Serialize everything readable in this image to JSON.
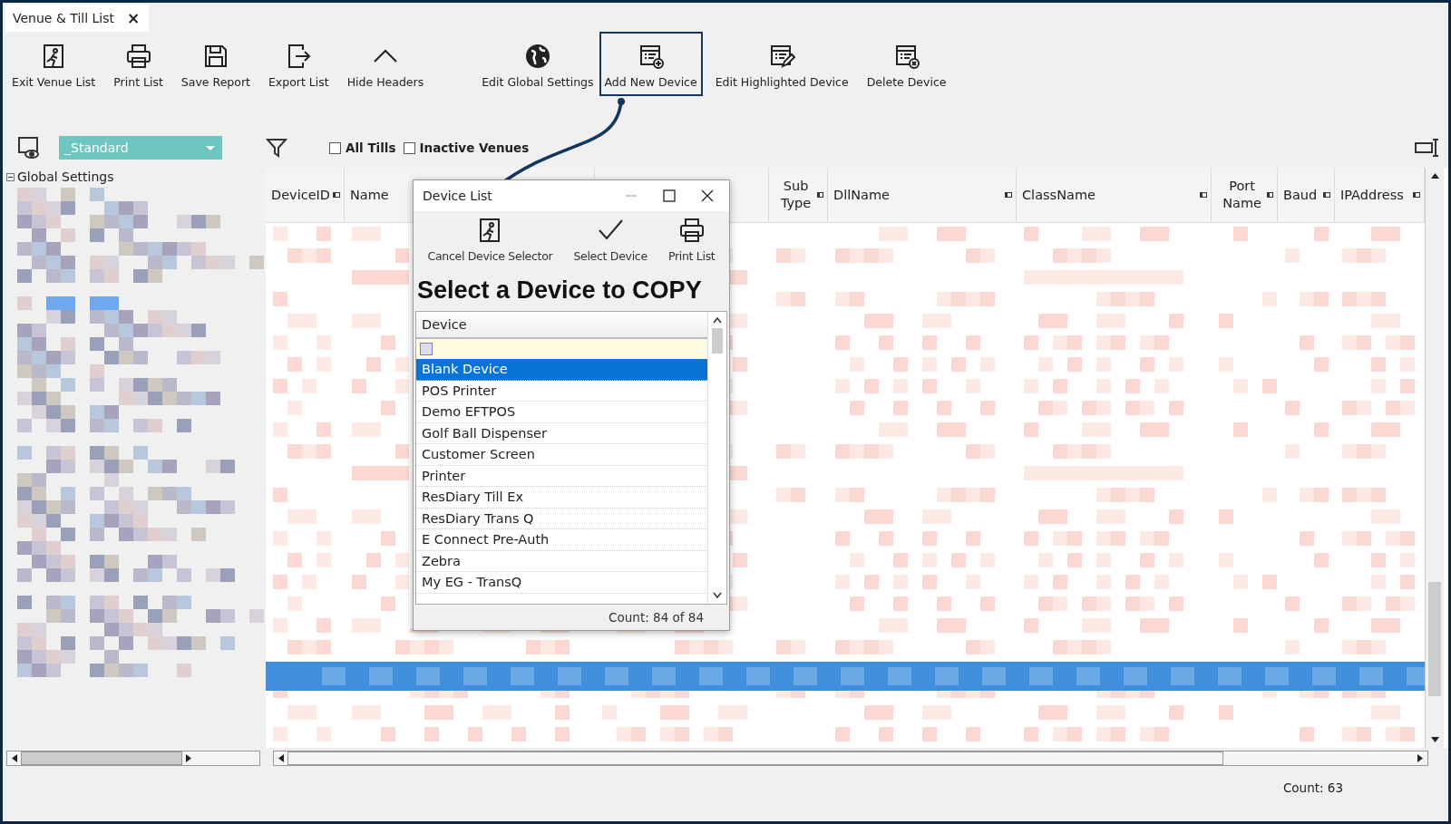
{
  "tab": {
    "title": "Venue & Till List",
    "close": "×"
  },
  "toolbar": [
    {
      "label": "Exit Venue List",
      "highlighted": false
    },
    {
      "label": "Print List",
      "highlighted": false
    },
    {
      "label": "Save Report",
      "highlighted": false
    },
    {
      "label": "Export List",
      "highlighted": false
    },
    {
      "label": "Hide Headers",
      "highlighted": false
    },
    {
      "label": "Edit Global Settings",
      "highlighted": false
    },
    {
      "label": "Add New Device",
      "highlighted": true
    },
    {
      "label": "Edit Highlighted Device",
      "highlighted": false
    },
    {
      "label": "Delete Device",
      "highlighted": false
    }
  ],
  "layout_dropdown": {
    "value": "_Standard"
  },
  "filters": [
    {
      "label": "All Tills",
      "checked": false
    },
    {
      "label": "Inactive Venues",
      "checked": false
    }
  ],
  "tree": {
    "root": "Global Settings",
    "expanded": true
  },
  "grid": {
    "columns": [
      "DeviceID",
      "Name",
      "Sub Type",
      "DllName",
      "ClassName",
      "Port Name",
      "Baud",
      "IPAddress"
    ]
  },
  "dialog": {
    "title": "Device List",
    "toolbar": [
      "Cancel Device Selector",
      "Select Device",
      "Print List"
    ],
    "heading": "Select a Device to COPY",
    "column": "Device",
    "rows": [
      {
        "name": "Blank Device",
        "selected": true
      },
      {
        "name": "POS Printer",
        "selected": false
      },
      {
        "name": "Demo EFTPOS",
        "selected": false
      },
      {
        "name": "Golf Ball Dispenser",
        "selected": false
      },
      {
        "name": "Customer Screen",
        "selected": false
      },
      {
        "name": "Printer",
        "selected": false
      },
      {
        "name": "ResDiary Till Ex",
        "selected": false
      },
      {
        "name": "ResDiary Trans Q",
        "selected": false
      },
      {
        "name": "E Connect Pre-Auth",
        "selected": false
      },
      {
        "name": "Zebra",
        "selected": false
      },
      {
        "name": "My EG - TransQ",
        "selected": false
      }
    ],
    "count": "Count: 84 of 84"
  },
  "status": {
    "count": "Count: 63"
  }
}
